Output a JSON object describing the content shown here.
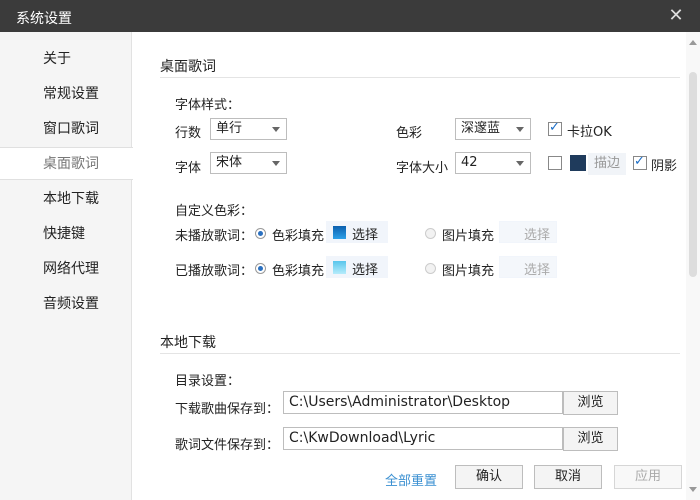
{
  "window": {
    "title": "系统设置",
    "close_icon": "close-icon"
  },
  "sidebar": {
    "items": [
      {
        "label": "关于"
      },
      {
        "label": "常规设置"
      },
      {
        "label": "窗口歌词"
      },
      {
        "label": "桌面歌词",
        "active": true
      },
      {
        "label": "本地下载"
      },
      {
        "label": "快捷键"
      },
      {
        "label": "网络代理"
      },
      {
        "label": "音频设置"
      }
    ]
  },
  "desktop_lyrics": {
    "section_title": "桌面歌词",
    "font_style_label": "字体样式：",
    "lines_label": "行数",
    "lines_value": "单行",
    "color_label": "色彩",
    "color_value": "深邃蓝",
    "karaoke_label": "卡拉OK",
    "karaoke_checked": true,
    "font_label": "字体",
    "font_value": "宋体",
    "font_size_label": "字体大小",
    "font_size_value": "42",
    "stroke_checked": false,
    "stroke_color": "#1f3b5c",
    "stroke_button": "描边",
    "shadow_label": "阴影",
    "shadow_checked": true,
    "custom_color_label": "自定义色彩：",
    "unplayed_label": "未播放歌词：",
    "played_label": "已播放歌词：",
    "color_fill_label": "色彩填充",
    "image_fill_label": "图片填充",
    "select_label": "选择",
    "unplayed_chip_color": "#1e7bc8",
    "played_chip_color": "#7fd6f0"
  },
  "local_download": {
    "section_title": "本地下载",
    "dir_settings_label": "目录设置：",
    "song_path_label": "下载歌曲保存到：",
    "song_path_value": "C:\\Users\\Administrator\\Desktop",
    "lyric_path_label": "歌词文件保存到：",
    "lyric_path_value": "C:\\KwDownload\\Lyric",
    "browse_label": "浏览"
  },
  "footer": {
    "reset_all": "全部重置",
    "ok": "确认",
    "cancel": "取消",
    "apply": "应用"
  }
}
